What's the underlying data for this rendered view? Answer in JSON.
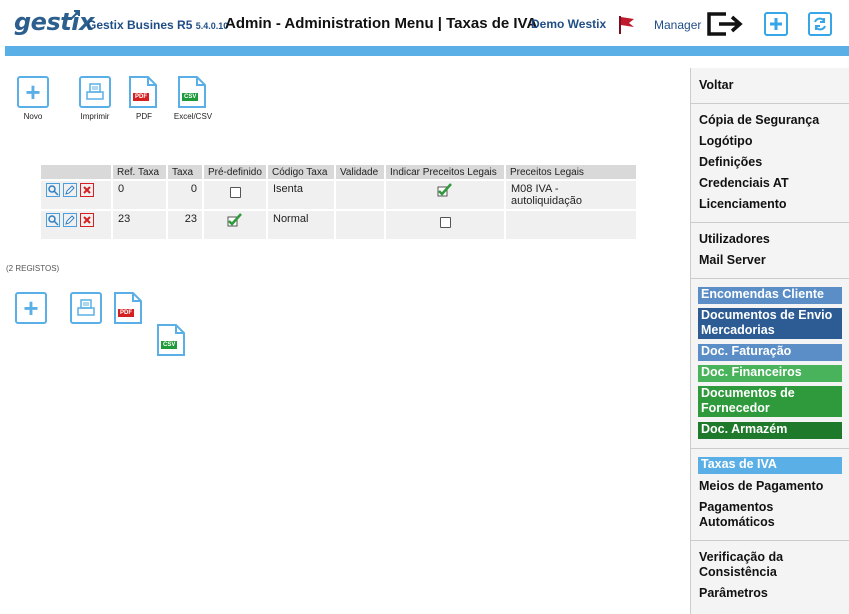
{
  "header": {
    "logo": "gestix",
    "product": "Gestix Busines R5",
    "version": "5.4.0.10",
    "title": "Admin - Administration Menu | Taxas de IVA",
    "company": "Demo Westix",
    "user": "Manager"
  },
  "toolbar": {
    "new_label": "Novo",
    "print_label": "Imprimir",
    "pdf_label": "PDF",
    "csv_label": "Excel/CSV",
    "pdf_tag": "PDF",
    "csv_tag": "CSV"
  },
  "table": {
    "columns": [
      "",
      "Ref. Taxa",
      "Taxa",
      "Pré-definido",
      "Código Taxa",
      "Validade",
      "Indicar Preceitos Legais",
      "Preceitos Legais"
    ],
    "rows": [
      {
        "ref": "0",
        "taxa": "0",
        "predefinido": false,
        "codigo": "Isenta",
        "validade": "",
        "indicar": true,
        "preceitos": "M08 IVA - autoliquidação"
      },
      {
        "ref": "23",
        "taxa": "23",
        "predefinido": true,
        "codigo": "Normal",
        "validade": "",
        "indicar": false,
        "preceitos": ""
      }
    ]
  },
  "record_count": "(2 REGISTOS)",
  "side_menu": {
    "voltar": "Voltar",
    "group1": [
      "Cópia de Segurança",
      "Logótipo",
      "Definições",
      "Credenciais AT",
      "Licenciamento"
    ],
    "group2": [
      "Utilizadores",
      "Mail Server"
    ],
    "group3": [
      {
        "label": "Encomendas Cliente",
        "color": "#5b8ec6"
      },
      {
        "label": "Documentos de Envio Mercadorias",
        "color": "#2d5c94"
      },
      {
        "label": "Doc. Faturação",
        "color": "#5b8ec6"
      },
      {
        "label": "Doc. Financeiros",
        "color": "#48b35a"
      },
      {
        "label": "Documentos de Fornecedor",
        "color": "#2f9a3c"
      },
      {
        "label": "Doc. Armazém",
        "color": "#1e7a2a"
      }
    ],
    "active": "Taxas de IVA",
    "group4": [
      "Meios de Pagamento",
      "Pagamentos Automáticos"
    ],
    "group5": [
      "Verificação da Consistência",
      "Parâmetros"
    ]
  },
  "colors": {
    "accent": "#5ab0e6",
    "brand": "#1f4e86",
    "active": "#5ab0e6"
  }
}
